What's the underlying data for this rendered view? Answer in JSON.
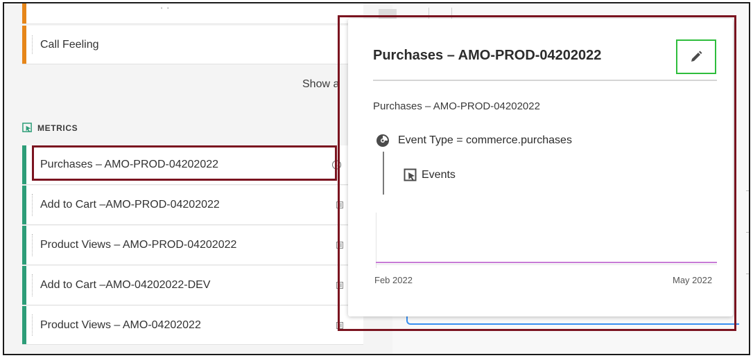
{
  "dimensions": {
    "partial_top_text": "' '",
    "call_feeling_label": "Call Feeling",
    "call_feeling_close": "×",
    "show_all_label": "Show a"
  },
  "metrics": {
    "heading": "METRICS",
    "items": [
      {
        "label": "Purchases – AMO-PROD-04202022"
      },
      {
        "label": "Add to Cart –AMO-PROD-04202022"
      },
      {
        "label": "Product Views – AMO-PROD-04202022"
      },
      {
        "label": "Add to Cart –AMO-04202022-DEV"
      },
      {
        "label": "Product Views – AMO-04202022"
      }
    ],
    "info_glyph": "i"
  },
  "popover": {
    "title": "Purchases – AMO-PROD-04202022",
    "description": "Purchases – AMO-PROD-04202022",
    "filter_text": "Event Type = commerce.purchases",
    "events_label": "Events",
    "chart_x_start": "Feb 2022",
    "chart_x_end": "May 2022",
    "icons": {
      "edit": "pencil-icon",
      "filter": "event-type-icon",
      "events": "metric-icon"
    }
  },
  "colors": {
    "dimension_bar": "#e68619",
    "metric_bar": "#2d9d78",
    "highlight": "#7b1420",
    "edit_highlight": "#2ebd3c",
    "sparkline": "#c77bd6"
  }
}
